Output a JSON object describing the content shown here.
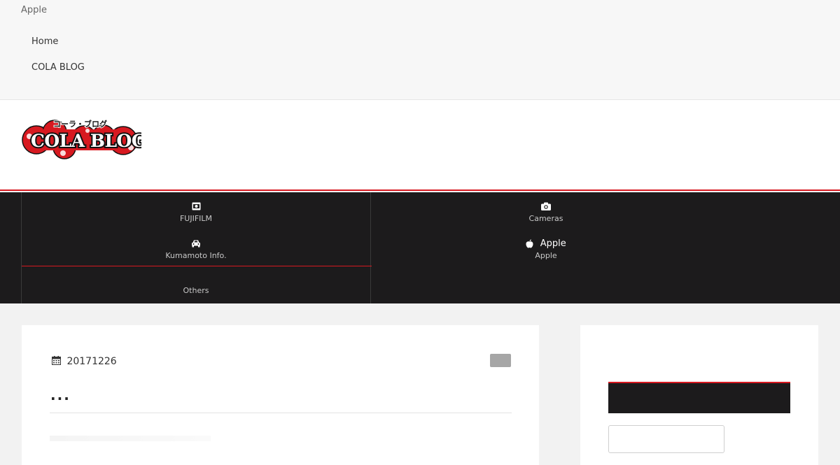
{
  "topbar": {
    "site_tag": "Apple",
    "nav": [
      {
        "label": "Home"
      },
      {
        "label": "COLA BLOG"
      }
    ]
  },
  "logo": {
    "main": "COLA BLOG",
    "kana": "コーラ・ブログ",
    "colors": {
      "red": "#d71920",
      "black": "#111111",
      "white": "#ffffff"
    }
  },
  "catnav": {
    "items": [
      {
        "label": "FUJIFILM",
        "icon": "film-camera-icon"
      },
      {
        "label": "Cameras",
        "icon": "camera-icon"
      },
      {
        "label": "Kumamoto Info.",
        "icon": "car-icon"
      },
      {
        "label": "Apple",
        "icon": "apple-icon",
        "icon_text": "Apple"
      },
      {
        "label": "Others"
      }
    ],
    "accent": "#d71920",
    "background": "#1c1b1c"
  },
  "article": {
    "date": "20171226",
    "date_icon": "calendar-icon",
    "title": "..."
  }
}
